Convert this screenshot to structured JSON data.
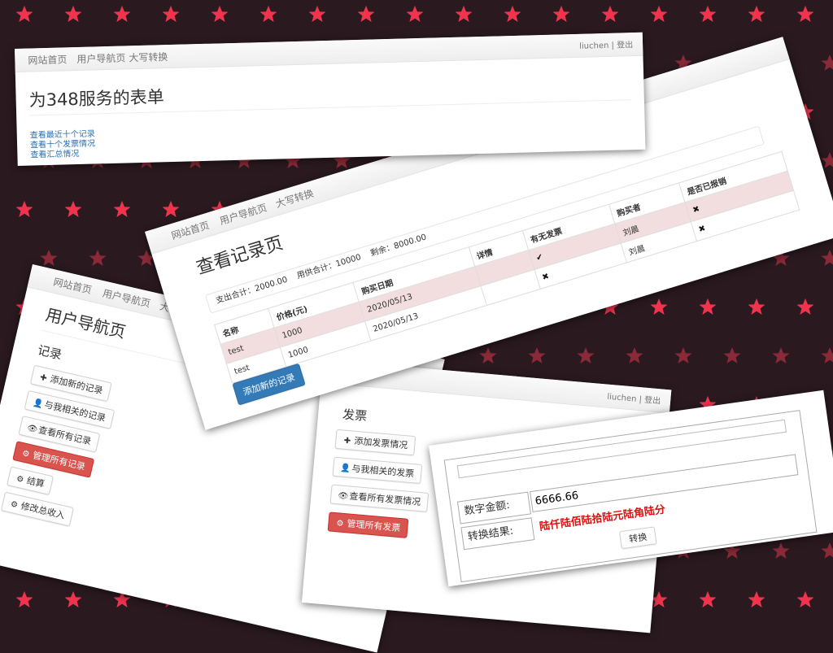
{
  "nav": {
    "home": "网站首页",
    "user_nav": "用户导航页",
    "convert": "大写转换",
    "user": "liuchen",
    "separator": "|",
    "logout": "登出"
  },
  "form_card": {
    "title": "为348服务的表单",
    "links": [
      "查看最近十个记录",
      "查看十个发票情况",
      "查看汇总情况"
    ]
  },
  "records_card": {
    "title": "查看记录页",
    "summary": {
      "spend_label": "支出合计：",
      "spend_value": "2000.00",
      "supply_label": "用供合计：",
      "supply_value": "10000",
      "remain_label": "剩余：",
      "remain_value": "8000.00"
    },
    "table": {
      "headers": [
        "名称",
        "价格(元)",
        "购买日期",
        "详情",
        "有无发票",
        "购买者",
        "是否已报销"
      ],
      "rows": [
        [
          "test",
          "1000",
          "2020/05/13",
          "",
          "✔",
          "刘晨",
          "✖"
        ],
        [
          "test",
          "1000",
          "2020/05/13",
          "",
          "✖",
          "刘晨",
          "✖"
        ]
      ]
    },
    "add_button": "添加新的记录"
  },
  "user_nav_card": {
    "title": "用户导航页",
    "records_heading": "记录",
    "buttons": {
      "add_record": "添加新的记录",
      "my_records": "与我相关的记录",
      "all_records": "查看所有记录",
      "manage_records": "管理所有记录",
      "settle": "结算",
      "edit_income": "修改总收入"
    }
  },
  "invoice_card": {
    "heading": "发票",
    "buttons": {
      "add_invoice": "添加发票情况",
      "my_invoices": "与我相关的发票",
      "all_invoices": "查看所有发票情况",
      "manage_invoices": "管理所有发票"
    }
  },
  "convert_card": {
    "amount_label": "数字金额:",
    "amount_value": "6666.66",
    "result_label": "转换结果:",
    "result_value": "陆仟陆佰陆拾陆元陆角陆分",
    "convert_button": "转换"
  },
  "colors": {
    "background": "#2a1a1f",
    "star_bright": "#f0344e",
    "star_dim": "#8a2a38",
    "danger": "#d9534f",
    "primary": "#337ab7",
    "pink_row": "#f2dede",
    "result_red": "#e01010"
  },
  "icons": {
    "plus": "plus-icon",
    "user": "user-icon",
    "eye": "eye-icon",
    "gear": "gear-icon",
    "check": "check-icon",
    "cross": "cross-icon"
  }
}
